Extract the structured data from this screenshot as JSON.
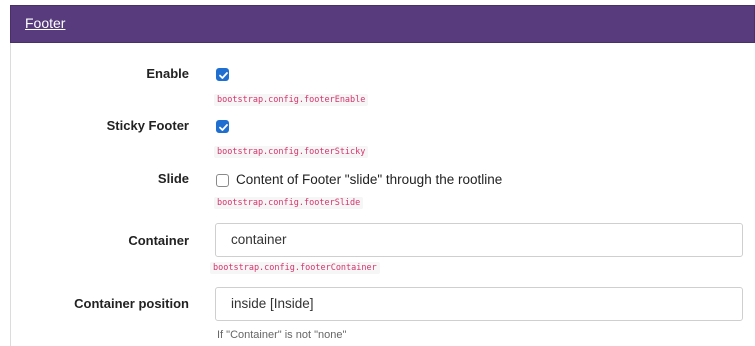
{
  "panel": {
    "title": "Footer",
    "header_color": "#583b7c"
  },
  "fields": {
    "enable": {
      "label": "Enable",
      "checked": true,
      "code": "bootstrap.config.footerEnable"
    },
    "sticky_footer": {
      "label": "Sticky Footer",
      "checked": true,
      "code": "bootstrap.config.footerSticky"
    },
    "slide": {
      "label": "Slide",
      "checked": false,
      "checkbox_text": "Content of Footer \"slide\" through the rootline",
      "code": "bootstrap.config.footerSlide"
    },
    "container": {
      "label": "Container",
      "value": "container",
      "code": "bootstrap.config.footerContainer"
    },
    "container_position": {
      "label": "Container position",
      "value": "inside [Inside]",
      "help": "If \"Container\" is not \"none\""
    }
  }
}
